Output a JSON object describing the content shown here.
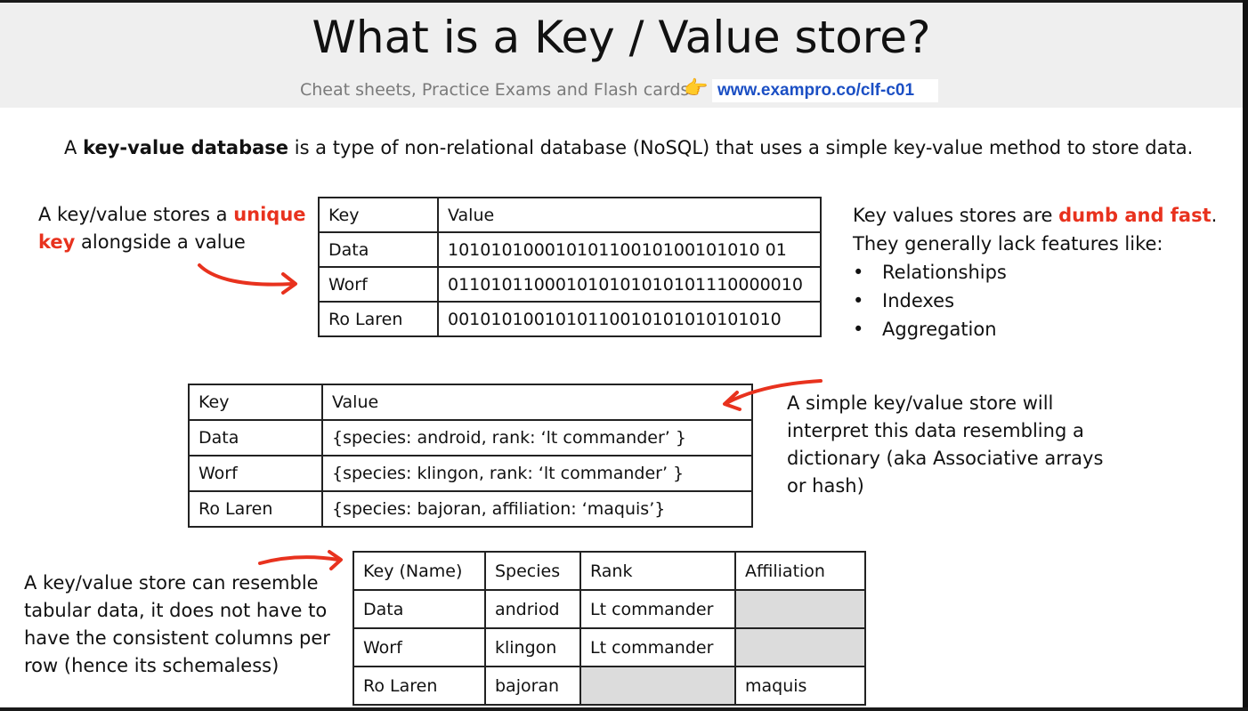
{
  "header": {
    "title": "What is a Key / Value store?",
    "subtitle": "Cheat sheets, Practice Exams and Flash cards",
    "pointer_icon": "backhand-index-pointing-right",
    "link": "www.exampro.co/clf-c01"
  },
  "intro": {
    "prefix": "A",
    "bold_term": "key-value database",
    "rest": "is a type of non-relational database (NoSQL) that uses a simple key-value method to store data."
  },
  "left_note": {
    "part1": "A key/value stores a",
    "highlight1": "unique",
    "highlight2": "key",
    "part2": "alongside a value"
  },
  "binary_table": {
    "headers": [
      "Key",
      "Value"
    ],
    "rows": [
      [
        "Data",
        "10101010001010110010100101010 01"
      ],
      [
        "Worf",
        "011010110001010101010101110000010"
      ],
      [
        "Ro Laren",
        "0010101001010110010101010101010"
      ]
    ]
  },
  "right_note": {
    "part1": "Key values stores are",
    "highlight": "dumb and fast",
    "period": ".",
    "line2": "They generally lack features like:",
    "features": [
      "Relationships",
      "Indexes",
      "Aggregation"
    ]
  },
  "dict_table": {
    "headers": [
      "Key",
      "Value"
    ],
    "rows": [
      [
        "Data",
        "{species: android, rank: ‘lt commander’ }"
      ],
      [
        "Worf",
        "{species: klingon, rank: ‘lt commander’ }"
      ],
      [
        "Ro Laren",
        "{species: bajoran, affiliation: ‘maquis’}"
      ]
    ]
  },
  "dict_note": {
    "lines": [
      "A simple key/value store will",
      "interpret this data resembling a",
      "dictionary (aka Associative arrays",
      "or hash)"
    ]
  },
  "tabular_note": {
    "lines": [
      "A key/value store can resemble",
      "tabular data, it does not have to",
      "have the consistent columns per",
      "row (hence its schemaless)"
    ]
  },
  "tabular_table": {
    "headers": [
      "Key (Name)",
      "Species",
      "Rank",
      "Affiliation"
    ],
    "rows": [
      [
        "Data",
        "andriod",
        "Lt commander",
        ""
      ],
      [
        "Worf",
        "klingon",
        "Lt commander",
        ""
      ],
      [
        "Ro Laren",
        "bajoran",
        "",
        "maquis"
      ]
    ]
  },
  "colors": {
    "accent_red": "#e8321e",
    "link_blue": "#1b4fc4",
    "empty_cell": "#dcdcdc",
    "header_bg": "#efefef"
  }
}
